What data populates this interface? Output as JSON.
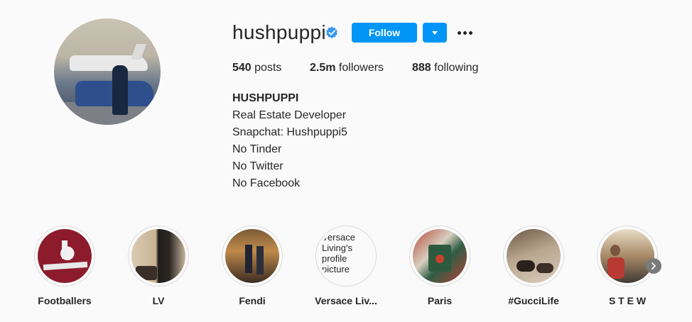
{
  "profile": {
    "username": "hushpuppi",
    "follow_label": "Follow",
    "accent": "#0095f6",
    "verified_color": "#3897f0",
    "stats": {
      "posts_count": "540",
      "posts_label": "posts",
      "followers_count": "2.5m",
      "followers_label": "followers",
      "following_count": "888",
      "following_label": "following"
    },
    "bio": {
      "name": "HUSHPUPPI",
      "lines": [
        "Real Estate Developer",
        "Snapchat: Hushpuppi5",
        "No Tinder",
        "No Twitter",
        "No Facebook"
      ]
    }
  },
  "highlights": [
    {
      "label": "Footballers",
      "icon": "jersey-image"
    },
    {
      "label": "LV",
      "icon": "interior-image"
    },
    {
      "label": "Fendi",
      "icon": "store-image"
    },
    {
      "label": "Versace Liv...",
      "alt_text": "Versace Living's profile picture"
    },
    {
      "label": "Paris",
      "icon": "gift-box-image"
    },
    {
      "label": "#GucciLife",
      "icon": "shoes-image"
    },
    {
      "label": "S T E W",
      "icon": "street-image"
    }
  ]
}
